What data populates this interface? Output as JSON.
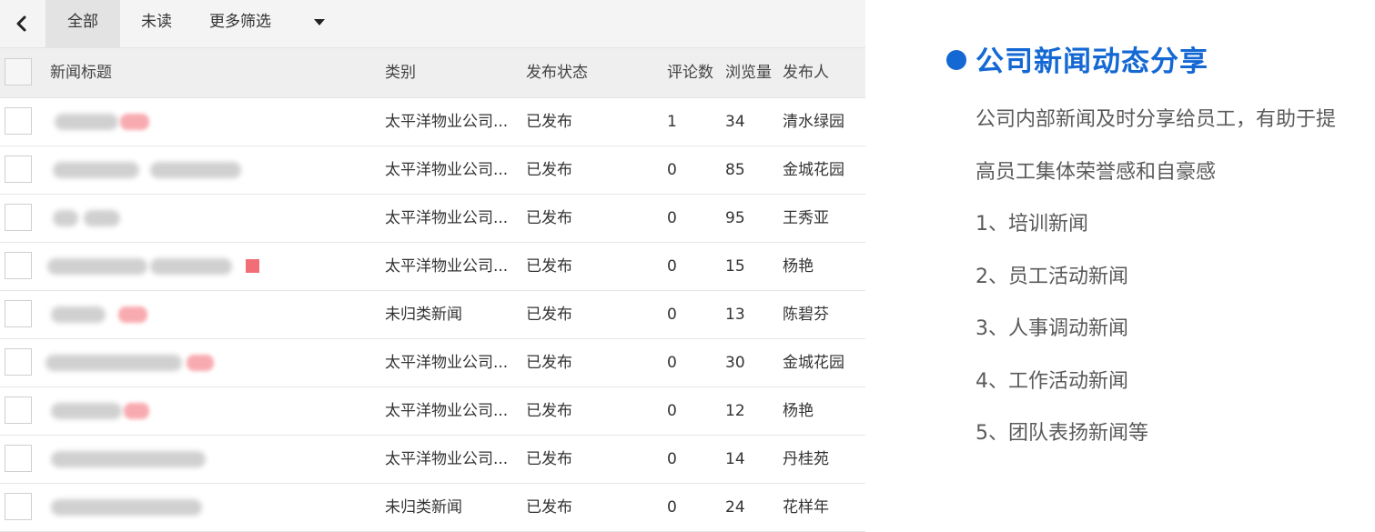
{
  "toolbar": {
    "back_icon": "chevron-left-icon",
    "tabs": [
      "全部",
      "未读",
      "更多筛选"
    ],
    "dropdown_icon": "caret-down-icon"
  },
  "table": {
    "columns": [
      "新闻标题",
      "类别",
      "发布状态",
      "评论数",
      "浏览量",
      "发布人"
    ],
    "rows": [
      {
        "category": "太平洋物业公司...",
        "status": "已发布",
        "comments": "1",
        "views": "34",
        "author": "清水绿园"
      },
      {
        "category": "太平洋物业公司...",
        "status": "已发布",
        "comments": "0",
        "views": "85",
        "author": "金城花园"
      },
      {
        "category": "太平洋物业公司...",
        "status": "已发布",
        "comments": "0",
        "views": "95",
        "author": "王秀亚"
      },
      {
        "category": "太平洋物业公司...",
        "status": "已发布",
        "comments": "0",
        "views": "15",
        "author": "杨艳"
      },
      {
        "category": "未归类新闻",
        "status": "已发布",
        "comments": "0",
        "views": "13",
        "author": "陈碧芬"
      },
      {
        "category": "太平洋物业公司...",
        "status": "已发布",
        "comments": "0",
        "views": "30",
        "author": "金城花园"
      },
      {
        "category": "太平洋物业公司...",
        "status": "已发布",
        "comments": "0",
        "views": "12",
        "author": "杨艳"
      },
      {
        "category": "太平洋物业公司...",
        "status": "已发布",
        "comments": "0",
        "views": "14",
        "author": "丹桂苑"
      },
      {
        "category": "未归类新闻",
        "status": "已发布",
        "comments": "0",
        "views": "24",
        "author": "花样年"
      }
    ]
  },
  "side": {
    "title": "公司新闻动态分享",
    "desc_line1": "公司内部新闻及时分享给员工，有助于提",
    "desc_line2": "高员工集体荣誉感和自豪感",
    "items": [
      "1、培训新闻",
      "2、员工活动新闻",
      "3、人事调动新闻",
      "4、工作活动新闻",
      "5、团队表扬新闻等"
    ]
  },
  "colors": {
    "accent": "#1368d4",
    "highlight": "#f26e76"
  }
}
